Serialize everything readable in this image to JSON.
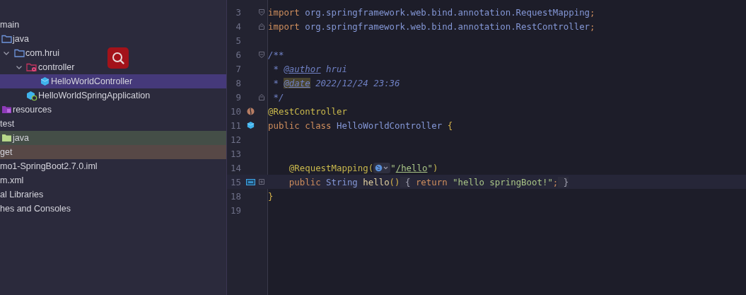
{
  "project_tree": [
    {
      "label": "main",
      "kind": "none",
      "selected": false,
      "children": [
        {
          "label": "java",
          "kind": "source-folder",
          "selected": false,
          "children": [
            {
              "label": "com.hrui",
              "kind": "package",
              "expanded": true,
              "selected": false,
              "children": [
                {
                  "label": "controller",
                  "kind": "controller-package",
                  "expanded": true,
                  "selected": false,
                  "children": [
                    {
                      "label": "HelloWorldController",
                      "kind": "class",
                      "selected": true
                    }
                  ]
                },
                {
                  "label": "HelloWorldSpringApplication",
                  "kind": "app-class",
                  "selected": false
                }
              ]
            }
          ]
        },
        {
          "label": "resources",
          "kind": "resources-folder",
          "selected": false
        }
      ]
    },
    {
      "label": "test",
      "kind": "none",
      "selected": false,
      "children": [
        {
          "label": "java",
          "kind": "test-folder",
          "selected": false,
          "color": "#444e47"
        }
      ]
    },
    {
      "label": "get",
      "kind": "none",
      "selected": false,
      "color": "#574846"
    },
    {
      "label": "mo1-SpringBoot2.7.0.iml",
      "kind": "none",
      "selected": false
    },
    {
      "label": "m.xml",
      "kind": "none",
      "selected": false
    },
    {
      "label": "al Libraries",
      "kind": "none",
      "selected": false
    },
    {
      "label": "hes and Consoles",
      "kind": "none",
      "selected": false
    }
  ],
  "editor": {
    "lines": [
      {
        "number": "3",
        "fold": {
          "kind": "start"
        },
        "current": false,
        "tokens": [
          {
            "kind": "keyword",
            "text": "import"
          },
          {
            "kind": "plain",
            "text": " org.springframework.web.bind.annotation.RequestMapping"
          },
          {
            "kind": "keyword",
            "text": ";"
          }
        ]
      },
      {
        "number": "4",
        "fold": {
          "kind": "end"
        },
        "current": false,
        "tokens": [
          {
            "kind": "keyword",
            "text": "import"
          },
          {
            "kind": "plain",
            "text": " org.springframework.web.bind.annotation.RestController"
          },
          {
            "kind": "keyword",
            "text": ";"
          }
        ]
      },
      {
        "number": "5",
        "current": false
      },
      {
        "number": "6",
        "fold": {
          "kind": "start"
        },
        "current": false,
        "tokens": [
          {
            "kind": "doc",
            "text": "/**"
          }
        ]
      },
      {
        "number": "7",
        "current": false,
        "tokens": [
          {
            "kind": "doc",
            "text": " * "
          },
          {
            "kind": "doc-tag",
            "text": "@author"
          },
          {
            "kind": "doc",
            "text": " hrui"
          }
        ]
      },
      {
        "number": "8",
        "current": false,
        "tokens": [
          {
            "kind": "doc",
            "text": " * "
          },
          {
            "kind": "doc-tag-marked",
            "text": "@date"
          },
          {
            "kind": "doc",
            "text": " 2022/12/24 23:36"
          }
        ]
      },
      {
        "number": "9",
        "fold": {
          "kind": "end"
        },
        "current": false,
        "tokens": [
          {
            "kind": "doc",
            "text": " */"
          }
        ]
      },
      {
        "number": "10",
        "marker": {
          "kind": "bean"
        },
        "current": false,
        "tokens": [
          {
            "kind": "annotation",
            "text": "@RestController"
          }
        ]
      },
      {
        "number": "11",
        "marker": {
          "kind": "class"
        },
        "current": false,
        "tokens": [
          {
            "kind": "keyword",
            "text": "public class"
          },
          {
            "kind": "class-name",
            "text": " HelloWorldController"
          },
          {
            "kind": "brace",
            "text": " {"
          }
        ]
      },
      {
        "number": "12",
        "current": false
      },
      {
        "number": "13",
        "current": false
      },
      {
        "number": "14",
        "current": false,
        "tokens": [
          {
            "kind": "annotation",
            "text": "    @RequestMapping("
          },
          {
            "kind": "url-inlay"
          },
          {
            "kind": "string",
            "text": "\""
          },
          {
            "kind": "string-link",
            "text": "/hello"
          },
          {
            "kind": "string",
            "text": "\""
          },
          {
            "kind": "annotation",
            "text": ")"
          }
        ]
      },
      {
        "number": "15",
        "marker": {
          "kind": "api"
        },
        "fold": {
          "kind": "collapsed"
        },
        "current": true,
        "tokens": [
          {
            "kind": "keyword",
            "text": "    public"
          },
          {
            "kind": "class-name",
            "text": " String"
          },
          {
            "kind": "method",
            "text": " hello"
          },
          {
            "kind": "brace",
            "text": "()"
          },
          {
            "kind": "folded",
            "text": " {"
          },
          {
            "kind": "keyword",
            "text": " return"
          },
          {
            "kind": "string",
            "text": " \"hello springBoot!\""
          },
          {
            "kind": "keyword",
            "text": ";"
          },
          {
            "kind": "folded",
            "text": " }"
          }
        ]
      },
      {
        "number": "18",
        "current": false,
        "tokens": [
          {
            "kind": "brace",
            "text": "}"
          }
        ]
      },
      {
        "number": "19",
        "current": false
      }
    ]
  }
}
